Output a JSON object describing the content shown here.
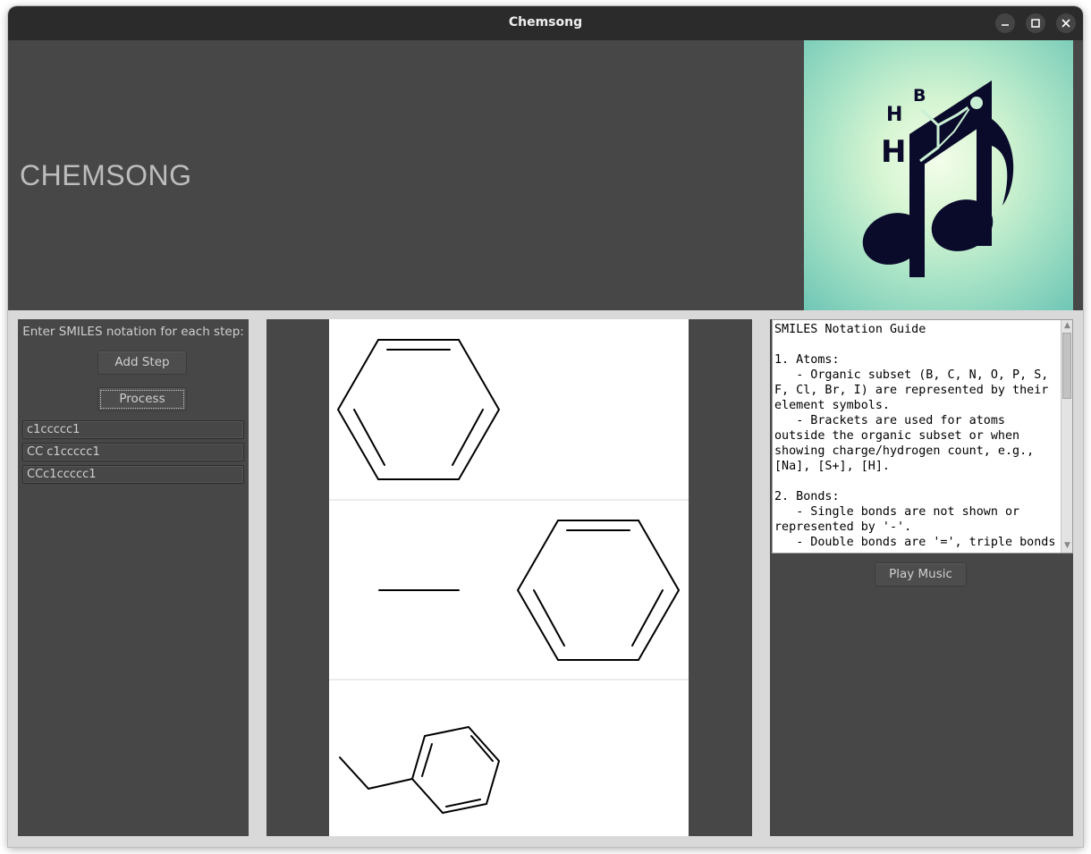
{
  "window": {
    "title": "Chemsong"
  },
  "header": {
    "app_title": "CHEMSONG",
    "logo_letters": [
      "B",
      "H",
      "H"
    ]
  },
  "left": {
    "instruction": "Enter SMILES notation for each step:",
    "add_step_label": "Add Step",
    "process_label": "Process",
    "steps": [
      "c1ccccc1",
      "CC c1ccccc1",
      "CCc1ccccc1"
    ]
  },
  "guide": {
    "text": "SMILES Notation Guide\n\n1. Atoms:\n   - Organic subset (B, C, N, O, P, S, F, Cl, Br, I) are represented by their element symbols.\n   - Brackets are used for atoms outside the organic subset or when showing charge/hydrogen count, e.g., [Na], [S+], [H].\n\n2. Bonds:\n   - Single bonds are not shown or represented by '-'.\n   - Double bonds are '=', triple bonds"
  },
  "right": {
    "play_label": "Play Music"
  },
  "colors": {
    "titlebar": "#2b2b2b",
    "panel": "#474747",
    "frame": "#d9d9d9",
    "logo_ink": "#0a0a2a",
    "logo_bg": "#c9f0d4"
  },
  "icons": {
    "minimize": "minimize-icon",
    "maximize": "maximize-icon",
    "close": "close-icon"
  }
}
